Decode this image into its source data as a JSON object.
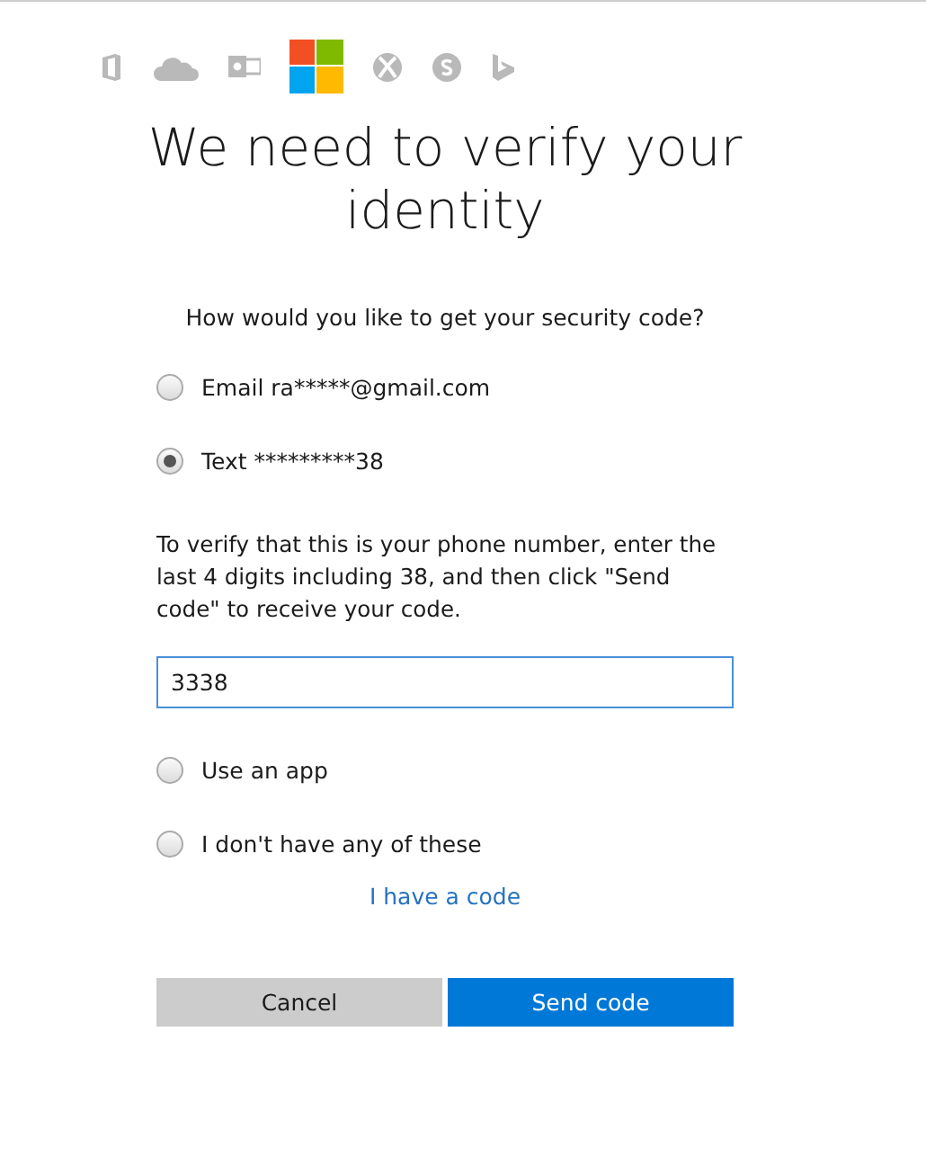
{
  "title_lines": [
    "We need to verify your",
    "identity"
  ],
  "question": "How would you like to get your security code?",
  "options": [
    {
      "label": "Email ra*****@gmail.com",
      "selected": false
    },
    {
      "label": "Text *********38",
      "selected": true,
      "prompt": "To verify that this is your phone number, enter the last 4 digits including 38, and then click \"Send code\" to receive your code.",
      "code_value": "3338"
    },
    {
      "label": "Use an app",
      "selected": false
    },
    {
      "label": "I don't have any of these",
      "selected": false
    }
  ],
  "link": "I have a code",
  "buttons": [
    {
      "label": "Cancel",
      "kind": "secondary"
    },
    {
      "label": "Send code",
      "kind": "primary"
    }
  ]
}
